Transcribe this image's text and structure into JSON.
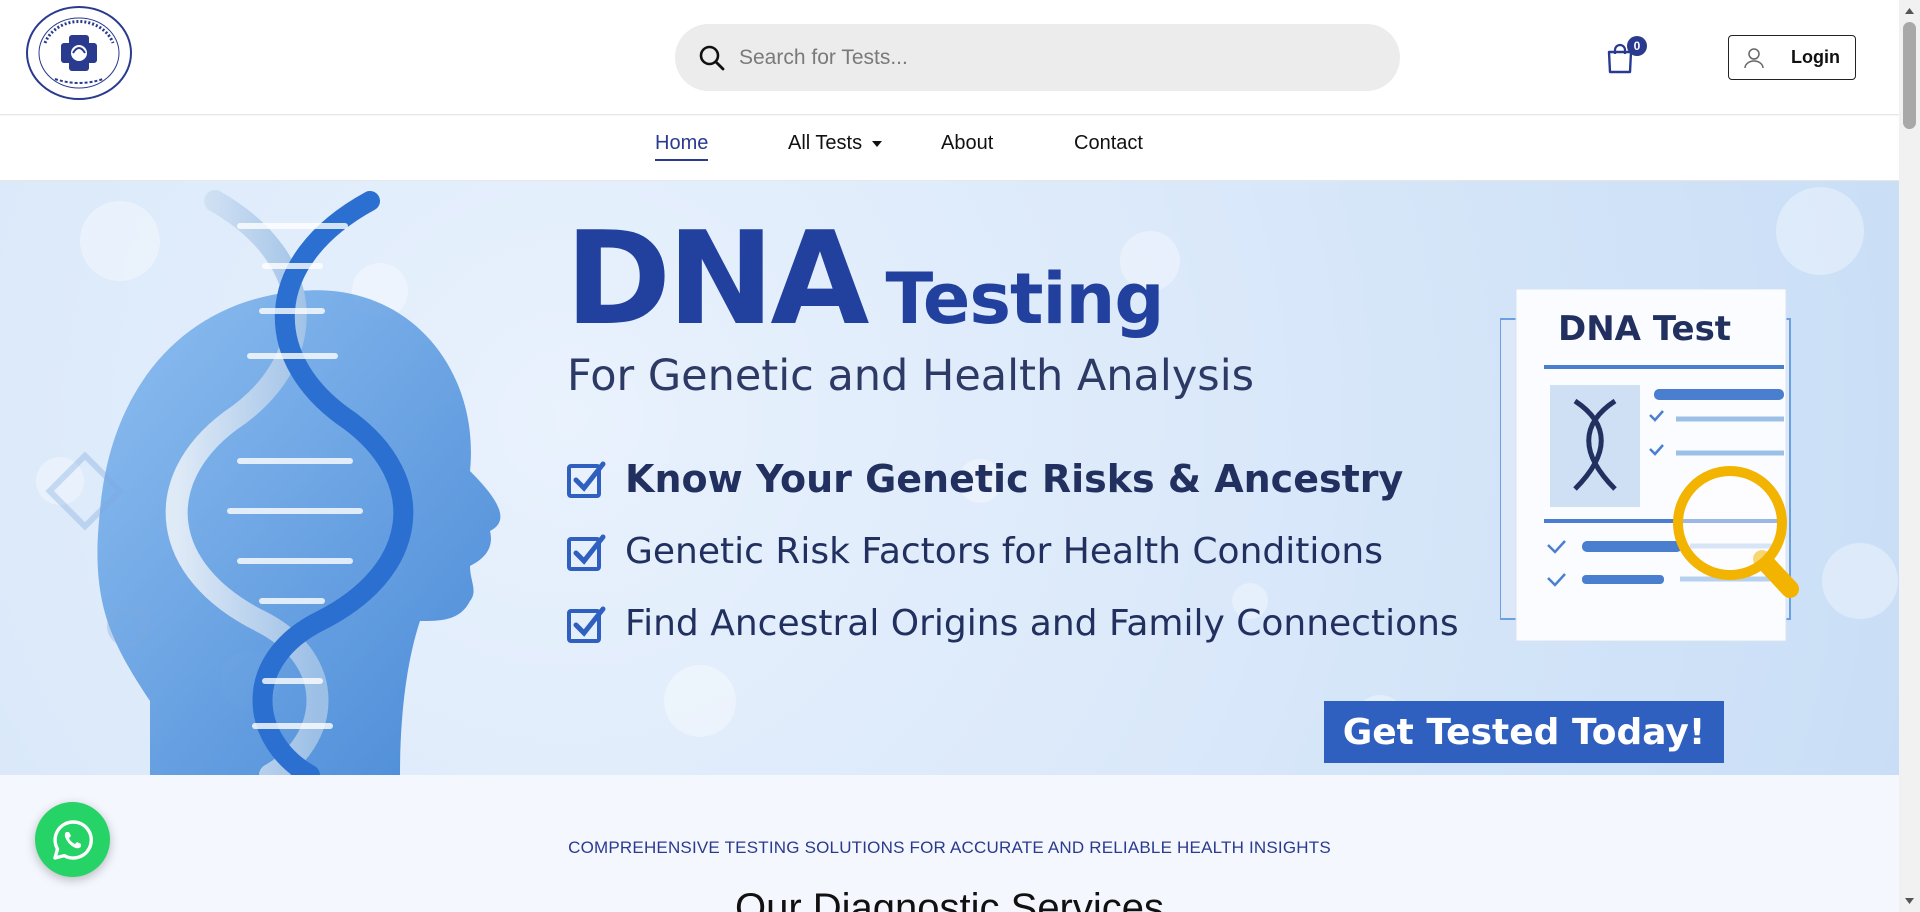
{
  "header": {
    "logo_alt": "Sahasya Diagnostic Centre",
    "search": {
      "placeholder": "Search for Tests..."
    },
    "cart": {
      "count": "0"
    },
    "login_label": "Login"
  },
  "nav": {
    "items": [
      {
        "label": "Home",
        "active": true
      },
      {
        "label": "All Tests",
        "has_dropdown": true
      },
      {
        "label": "About"
      },
      {
        "label": "Contact"
      }
    ]
  },
  "banner": {
    "headline_big": "DNA",
    "headline_mid": "Testing",
    "subhead": "For Genetic and Health Analysis",
    "bullets": [
      "Know Your Genetic Risks & Ancestry",
      "Genetic Risk Factors for Health Conditions",
      "Find Ancestral Origins and Family Connections"
    ],
    "card_title": "DNA Test",
    "cta": "Get Tested Today!"
  },
  "section": {
    "tagline": "COMPREHENSIVE TESTING SOLUTIONS FOR ACCURATE AND RELIABLE HEALTH INSIGHTS",
    "title": "Our Diagnostic Services"
  },
  "colors": {
    "brand": "#2a3a8f",
    "banner_blue": "#22409e",
    "cta_blue": "#2f5fbf",
    "whatsapp_green": "#25d366"
  }
}
